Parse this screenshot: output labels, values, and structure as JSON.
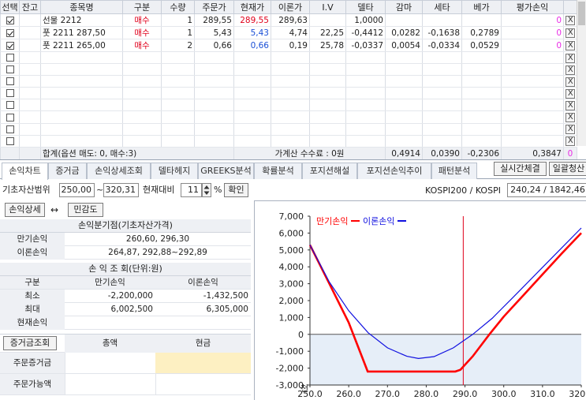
{
  "grid": {
    "columns": [
      "선택",
      "잔고",
      "종목명",
      "구분",
      "수량",
      "주문가",
      "현재가",
      "이론가",
      "I.V",
      "델타",
      "감마",
      "세타",
      "베가",
      "평가손익"
    ],
    "rows": [
      {
        "checked": true,
        "name": "선물 2212",
        "side": "매수",
        "qty": "1",
        "order_price": "289,55",
        "current": "289,55",
        "theory": "289,63",
        "iv": "",
        "delta": "1,0000",
        "gamma": "",
        "theta": "",
        "vega": "",
        "pnl": "0"
      },
      {
        "checked": true,
        "name": "풋 2211 287,50",
        "side": "매수",
        "qty": "1",
        "order_price": "5,43",
        "current": "5,43",
        "theory": "4,74",
        "iv": "22,25",
        "delta": "-0,4412",
        "gamma": "0,0282",
        "theta": "-0,1638",
        "vega": "0,2789",
        "pnl": "0"
      },
      {
        "checked": true,
        "name": "풋 2211 265,00",
        "side": "매수",
        "qty": "2",
        "order_price": "0,66",
        "current": "0,66",
        "theory": "0,19",
        "iv": "25,78",
        "delta": "-0,0337",
        "gamma": "0,0054",
        "theta": "-0,0334",
        "vega": "0,0529",
        "pnl": "0"
      }
    ],
    "empty_rows": 8,
    "remove_label": "X",
    "total": {
      "label": "합계(옵션 매도: 0, 매수:3)",
      "fee": "가계산 수수료 : 0원",
      "delta": "0,4914",
      "gamma": "0,0390",
      "theta": "-0,2306",
      "vega": "0,3847",
      "pnl": "0"
    }
  },
  "tabs": [
    "손익차트",
    "증거금",
    "손익상세조회",
    "델타헤지",
    "GREEKS분석",
    "확률분석",
    "포지션해설",
    "포지션손익추이",
    "패턴분석"
  ],
  "buttons": {
    "realtime": "실시간체결",
    "batch": "일괄청산"
  },
  "controls": {
    "range_label": "기초자산범위",
    "range_from": "250,00",
    "tilde": "~",
    "range_to": "320,31",
    "compare_label": "현재대비",
    "percent_value": "11",
    "percent_sign": "%",
    "confirm": "확인",
    "kospi_label": "KOSPI200 / KOSPI",
    "kospi_value": "240,24 / 1842,46",
    "pnl_detail": "손익상세",
    "swap_icon": "↔",
    "sensitivity": "민감도"
  },
  "breakeven": {
    "title": "손익분기점(기초자산가격)",
    "rows": [
      {
        "label": "만기손익",
        "value": "260,60, 296,30"
      },
      {
        "label": "이론손익",
        "value": "264,87, 292,88~292,89"
      }
    ]
  },
  "pnl_table": {
    "title": "손 익 조 회(단위:원)",
    "headers": [
      "구분",
      "만기손익",
      "이론손익"
    ],
    "rows": [
      {
        "label": "최소",
        "expiry": "-2,200,000",
        "theory": "-1,432,500"
      },
      {
        "label": "최대",
        "expiry": "6,002,500",
        "theory": "6,305,000"
      },
      {
        "label": "현재손익",
        "expiry": "",
        "theory": ""
      }
    ]
  },
  "margin_table": {
    "headers": [
      "증거금조회",
      "총액",
      "현금"
    ],
    "rows": [
      {
        "label": "주문증거금"
      },
      {
        "label": "주문가능액"
      }
    ]
  },
  "colors": {
    "expiry_line": "#ff0000",
    "theory_line": "#1010e0",
    "accent_pink": "#e92de6",
    "highlight": "#fdf0c2"
  },
  "chart_data": {
    "type": "line",
    "y_unit": "천",
    "ylim": [
      -3000,
      7000
    ],
    "xlim": [
      250,
      320
    ],
    "yticks": [
      "7,000",
      "6,000",
      "5,000",
      "4,000",
      "3,000",
      "2,000",
      "1,000",
      "0",
      "-1,000",
      "-2,000",
      "-3,000"
    ],
    "xticks": [
      "250.0",
      "260.0",
      "270.0",
      "280.0",
      "290.0",
      "300.0",
      "310.0",
      "320.0"
    ],
    "current_x": 289.55,
    "series": [
      {
        "name": "만기손익",
        "color": "#ff0000",
        "x": [
          250,
          255,
          260,
          264.9,
          275,
          287.5,
          288.8,
          292,
          296.3,
          300,
          305,
          310,
          315,
          320
        ],
        "y": [
          5300,
          3000,
          700,
          -2200,
          -2200,
          -2200,
          -2100,
          -1300,
          0,
          1050,
          2300,
          3550,
          4800,
          6000
        ]
      },
      {
        "name": "이론손익",
        "color": "#1010e0",
        "x": [
          250,
          255,
          260,
          265,
          270,
          275,
          278,
          282,
          287,
          292,
          297,
          302,
          308,
          314,
          320
        ],
        "y": [
          5300,
          3100,
          1400,
          100,
          -800,
          -1300,
          -1430,
          -1320,
          -800,
          0,
          950,
          2100,
          3500,
          4900,
          6300
        ]
      }
    ]
  }
}
